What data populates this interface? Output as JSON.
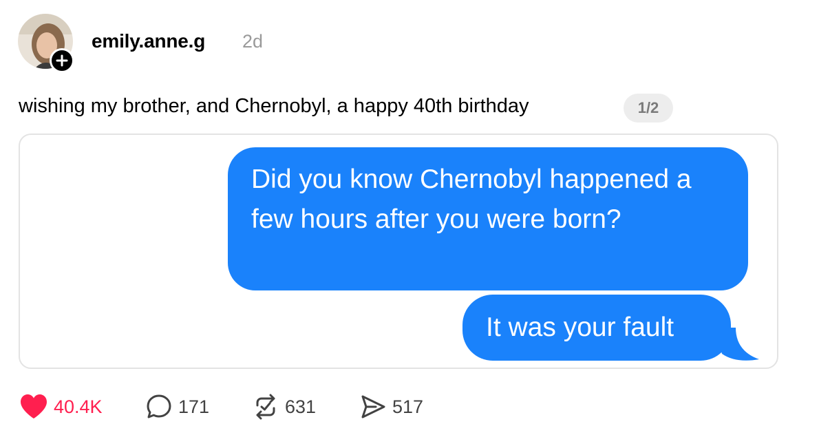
{
  "post": {
    "username": "emily.anne.g",
    "timestamp": "2d",
    "caption": "wishing my brother, and Chernobyl, a happy 40th birthday",
    "page_indicator": "1/2"
  },
  "media": {
    "messages": [
      {
        "text": "Did you know Chernobyl happened a few hours after you were born?",
        "sender": "me"
      },
      {
        "text": "It was your fault",
        "sender": "me"
      }
    ],
    "bubble_color": "#1a82fb"
  },
  "actions": {
    "likes": "40.4K",
    "replies": "171",
    "reposts": "631",
    "shares": "517",
    "like_color": "#ff1f4f"
  },
  "icons": {
    "avatar": "profile-photo",
    "follow": "plus-icon",
    "like": "heart-icon",
    "reply": "speech-bubble-icon",
    "repost": "repost-icon",
    "share": "paper-plane-icon"
  }
}
